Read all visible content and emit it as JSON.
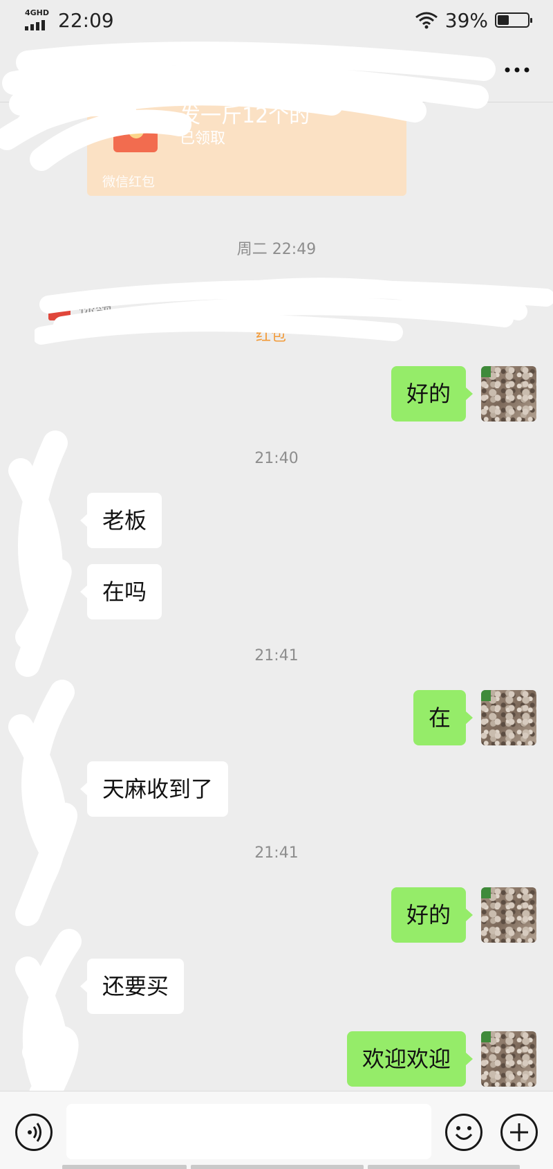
{
  "status_bar": {
    "network": "4GHD",
    "time": "22:09",
    "battery_percent": "39%",
    "battery_level": 0.39
  },
  "nav": {
    "title": "",
    "back_icon": "chevron-left-icon",
    "more_icon": "more-dots-icon"
  },
  "red_packet": {
    "text": "发一斤12个的",
    "status": "已领取",
    "brand": "微信红包"
  },
  "system_notice": {
    "text": "你领",
    "link": "红包"
  },
  "timestamps": [
    "周二 22:49",
    "21:40",
    "21:41",
    "21:41"
  ],
  "messages": [
    {
      "side": "out",
      "text": "好的"
    },
    {
      "side": "in",
      "text": "老板"
    },
    {
      "side": "in",
      "text": "在吗"
    },
    {
      "side": "out",
      "text": "在"
    },
    {
      "side": "in",
      "text": "天麻收到了"
    },
    {
      "side": "out",
      "text": "好的"
    },
    {
      "side": "in",
      "text": "还要买"
    },
    {
      "side": "out",
      "text": "欢迎欢迎"
    }
  ],
  "input_bar": {
    "value": "",
    "placeholder": "",
    "icons": [
      "voice-icon",
      "emoji-icon",
      "plus-icon"
    ]
  },
  "colors": {
    "background": "#ededed",
    "outgoing_bubble": "#95ec69",
    "incoming_bubble": "#ffffff",
    "red_packet": "#fbe1c4",
    "link_orange": "#f29a38"
  }
}
